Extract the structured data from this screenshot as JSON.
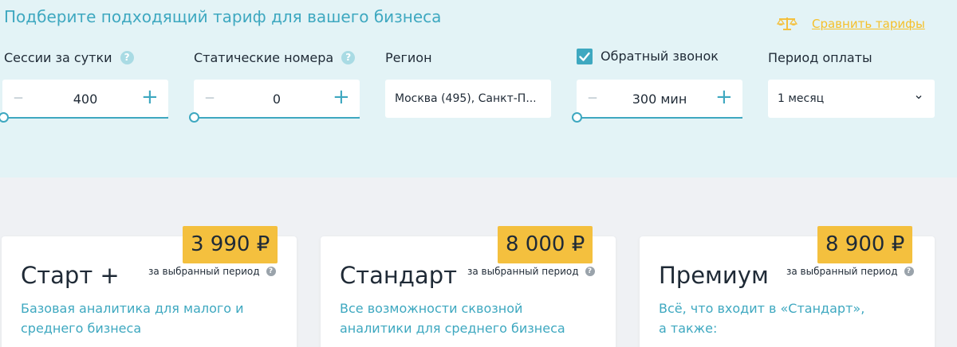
{
  "header": {
    "title": "Подберите подходящий тариф для вашего бизнеса",
    "compare_label": "Сравнить тарифы",
    "compare_icon": "scales-icon"
  },
  "fields": {
    "sessions": {
      "label": "Сессии за сутки",
      "value": "400"
    },
    "static_numbers": {
      "label": "Статические номера",
      "value": "0"
    },
    "region": {
      "label": "Регион",
      "value": "Москва (495), Санкт-П..."
    },
    "callback": {
      "label": "Обратный звонок",
      "checked": true,
      "value": "300 мин"
    },
    "period": {
      "label": "Период оплаты",
      "value": "1 месяц"
    }
  },
  "plans": [
    {
      "name": "Старт +",
      "price": "3 990 ₽",
      "period_note": "за выбранный период",
      "desc_line1": "Базовая аналитика для малого и",
      "desc_line2": "среднего бизнеса"
    },
    {
      "name": "Стандарт",
      "price": "8 000 ₽",
      "period_note": "за выбранный период",
      "desc_line1": "Все возможности сквозной",
      "desc_line2": "аналитики для среднего бизнеса"
    },
    {
      "name": "Премиум",
      "price": "8 900 ₽",
      "period_note": "за выбранный период",
      "desc_line1": "Всё, что входит в «Стандарт»,",
      "desc_line2": "а также:"
    }
  ],
  "colors": {
    "accent": "#3ea8c0",
    "price_badge": "#f4c03e",
    "link": "#f5c02b",
    "config_bg": "#e3f3f6"
  }
}
